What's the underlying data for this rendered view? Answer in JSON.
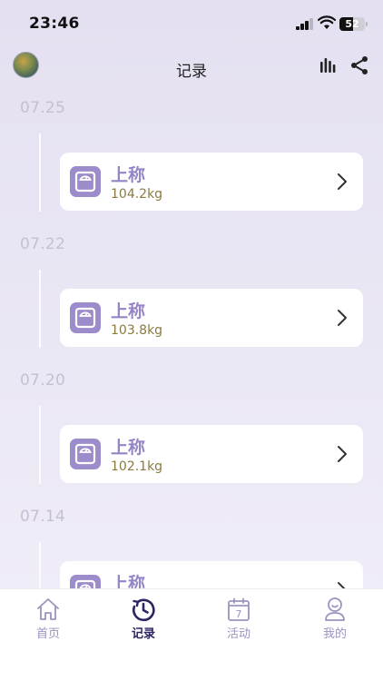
{
  "status_bar": {
    "time": "23:46",
    "battery": "52"
  },
  "nav": {
    "title": "记录",
    "left_icon": "avatar",
    "right_icons": [
      "bar-chart-icon",
      "share-icon"
    ]
  },
  "records": [
    {
      "date": "07.25",
      "title": "上称",
      "weight": "104.2kg"
    },
    {
      "date": "07.22",
      "title": "上称",
      "weight": "103.8kg"
    },
    {
      "date": "07.20",
      "title": "上称",
      "weight": "102.1kg"
    },
    {
      "date": "07.14",
      "title": "上称",
      "weight": ""
    }
  ],
  "tabs": [
    {
      "label": "首页",
      "icon": "home-icon",
      "active": false
    },
    {
      "label": "记录",
      "icon": "records-icon",
      "active": true
    },
    {
      "label": "活动",
      "icon": "calendar-icon",
      "active": false,
      "icon_text": "7"
    },
    {
      "label": "我的",
      "icon": "profile-icon",
      "active": false
    }
  ],
  "colors": {
    "accent": "#9584c6",
    "weight_text": "#8a7a40",
    "active_tab": "#2b2560",
    "inactive_tab": "#9a94c0",
    "date_text": "#c4c0d3"
  }
}
